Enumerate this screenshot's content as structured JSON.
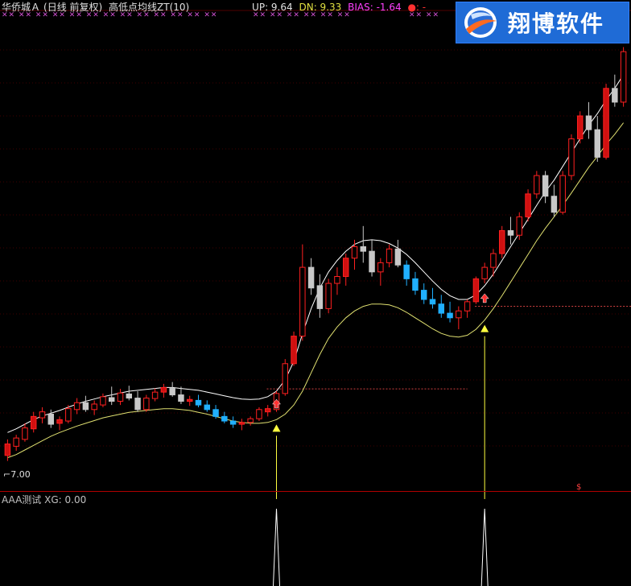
{
  "header": {
    "stock_name": "华侨城Ａ",
    "period": "(日线 前复权)",
    "indicator_name": "高低点均线ZT(10)",
    "up_label": "UP: 9.64",
    "dn_label": "DN: 9.33",
    "bias_label": "BIAS: -1.64",
    "dot_label": "●: -",
    "x_marks_left": "✕✕ ✕✕ ✕✕ ✕✕ ✕✕ ✕✕ ✕✕ ✕✕ ✕✕ ✕✕ ✕✕ ✕✕ ✕✕",
    "x_marks_mid": "✕✕ ✕✕ ✕✕ ✕✕ ✕✕ ✕✕",
    "x_marks_right": "✕✕ ✕✕"
  },
  "logo": {
    "text": "翔博软件"
  },
  "low_price_label": "7.00",
  "sub_panel": {
    "title": "AAA测试",
    "value_label": "XG: 0.00"
  },
  "colors": {
    "up": "#ff2020",
    "up_body": "#d01010",
    "down": "#20b0ff",
    "neutral": "#c8c8c8",
    "upper_line": "#ffffff",
    "lower_line": "#e0e070",
    "signal": "#ffff40"
  },
  "icons": {
    "signal_arrow": "up-arrow-icon",
    "buy_marker": "red-up-arrow-icon"
  },
  "chart_data": {
    "type": "candlestick",
    "note_ohlc": "o,h,l,c",
    "candles": [
      [
        7.1,
        7.45,
        6.98,
        7.35
      ],
      [
        7.3,
        7.55,
        7.2,
        7.48
      ],
      [
        7.45,
        7.8,
        7.4,
        7.7
      ],
      [
        7.68,
        8.05,
        7.6,
        7.95
      ],
      [
        7.92,
        8.15,
        7.8,
        8.05
      ],
      [
        8.0,
        8.1,
        7.7,
        7.78
      ],
      [
        7.8,
        7.95,
        7.65,
        7.88
      ],
      [
        7.85,
        8.2,
        7.8,
        8.12
      ],
      [
        8.1,
        8.35,
        8.0,
        8.25
      ],
      [
        8.25,
        8.4,
        8.05,
        8.1
      ],
      [
        8.1,
        8.3,
        7.98,
        8.22
      ],
      [
        8.2,
        8.45,
        8.15,
        8.38
      ],
      [
        8.36,
        8.6,
        8.2,
        8.28
      ],
      [
        8.28,
        8.55,
        8.2,
        8.46
      ],
      [
        8.44,
        8.62,
        8.3,
        8.35
      ],
      [
        8.35,
        8.5,
        8.05,
        8.1
      ],
      [
        8.1,
        8.42,
        8.05,
        8.35
      ],
      [
        8.34,
        8.56,
        8.28,
        8.48
      ],
      [
        8.48,
        8.66,
        8.36,
        8.58
      ],
      [
        8.56,
        8.7,
        8.38,
        8.42
      ],
      [
        8.42,
        8.6,
        8.22,
        8.28
      ],
      [
        8.28,
        8.4,
        8.18,
        8.32
      ],
      [
        8.3,
        8.42,
        8.15,
        8.2
      ],
      [
        8.2,
        8.3,
        8.05,
        8.1
      ],
      [
        8.1,
        8.2,
        7.9,
        7.95
      ],
      [
        7.95,
        8.05,
        7.8,
        7.85
      ],
      [
        7.85,
        7.95,
        7.7,
        7.78
      ],
      [
        7.78,
        7.9,
        7.65,
        7.82
      ],
      [
        7.82,
        7.95,
        7.75,
        7.9
      ],
      [
        7.9,
        8.15,
        7.85,
        8.1
      ],
      [
        8.05,
        8.2,
        7.95,
        8.12
      ],
      [
        8.1,
        8.5,
        8.05,
        8.45
      ],
      [
        8.45,
        9.2,
        8.4,
        9.1
      ],
      [
        9.1,
        9.8,
        9.05,
        9.7
      ],
      [
        9.7,
        11.7,
        9.6,
        11.2
      ],
      [
        11.2,
        11.4,
        10.6,
        10.75
      ],
      [
        10.8,
        11.05,
        10.1,
        10.3
      ],
      [
        10.3,
        10.95,
        10.2,
        10.85
      ],
      [
        10.85,
        11.2,
        10.6,
        11.0
      ],
      [
        11.0,
        11.5,
        10.8,
        11.4
      ],
      [
        11.4,
        11.8,
        11.15,
        11.65
      ],
      [
        11.65,
        12.1,
        11.3,
        11.55
      ],
      [
        11.55,
        11.8,
        11.0,
        11.1
      ],
      [
        11.1,
        11.4,
        10.8,
        11.3
      ],
      [
        11.3,
        11.7,
        11.2,
        11.6
      ],
      [
        11.6,
        11.8,
        11.2,
        11.25
      ],
      [
        11.25,
        11.35,
        10.8,
        10.95
      ],
      [
        10.95,
        11.1,
        10.6,
        10.7
      ],
      [
        10.7,
        10.85,
        10.4,
        10.5
      ],
      [
        10.5,
        10.75,
        10.3,
        10.4
      ],
      [
        10.4,
        10.6,
        10.1,
        10.2
      ],
      [
        10.2,
        10.45,
        10.0,
        10.1
      ],
      [
        10.1,
        10.35,
        9.85,
        10.25
      ],
      [
        10.25,
        10.5,
        10.1,
        10.45
      ],
      [
        10.45,
        11.0,
        10.4,
        10.95
      ],
      [
        10.95,
        11.3,
        10.85,
        11.2
      ],
      [
        11.2,
        11.6,
        11.0,
        11.5
      ],
      [
        11.5,
        12.1,
        11.4,
        12.0
      ],
      [
        12.0,
        12.3,
        11.7,
        11.9
      ],
      [
        11.9,
        12.4,
        11.8,
        12.3
      ],
      [
        12.3,
        12.9,
        12.2,
        12.8
      ],
      [
        12.8,
        13.3,
        12.7,
        13.2
      ],
      [
        13.2,
        13.3,
        12.6,
        12.75
      ],
      [
        12.75,
        13.0,
        12.3,
        12.4
      ],
      [
        12.4,
        13.3,
        12.35,
        13.2
      ],
      [
        13.2,
        14.1,
        13.1,
        14.0
      ],
      [
        14.0,
        14.6,
        13.9,
        14.5
      ],
      [
        14.5,
        14.8,
        14.0,
        14.2
      ],
      [
        14.2,
        14.5,
        13.5,
        13.6
      ],
      [
        13.6,
        15.2,
        13.55,
        15.1
      ],
      [
        15.1,
        15.4,
        14.7,
        14.8
      ],
      [
        14.8,
        16.0,
        14.7,
        15.9
      ]
    ],
    "upper_band": [
      7.6,
      7.68,
      7.78,
      7.88,
      7.96,
      8.02,
      8.08,
      8.15,
      8.22,
      8.28,
      8.33,
      8.38,
      8.42,
      8.46,
      8.5,
      8.52,
      8.54,
      8.56,
      8.58,
      8.58,
      8.56,
      8.54,
      8.52,
      8.48,
      8.44,
      8.4,
      8.36,
      8.33,
      8.32,
      8.33,
      8.38,
      8.5,
      8.75,
      9.15,
      9.75,
      10.3,
      10.75,
      11.1,
      11.35,
      11.55,
      11.7,
      11.78,
      11.8,
      11.78,
      11.72,
      11.62,
      11.48,
      11.3,
      11.1,
      10.9,
      10.72,
      10.58,
      10.5,
      10.5,
      10.6,
      10.8,
      11.05,
      11.35,
      11.65,
      11.95,
      12.25,
      12.55,
      12.85,
      13.1,
      13.4,
      13.7,
      14.0,
      14.3,
      14.55,
      14.85,
      15.1,
      15.4
    ],
    "lower_band": [
      7.05,
      7.12,
      7.22,
      7.32,
      7.42,
      7.52,
      7.6,
      7.67,
      7.74,
      7.8,
      7.86,
      7.92,
      7.96,
      8.0,
      8.04,
      8.06,
      8.08,
      8.1,
      8.12,
      8.12,
      8.1,
      8.08,
      8.04,
      8.0,
      7.95,
      7.9,
      7.85,
      7.82,
      7.8,
      7.8,
      7.82,
      7.88,
      8.0,
      8.2,
      8.5,
      8.9,
      9.3,
      9.65,
      9.9,
      10.1,
      10.25,
      10.35,
      10.4,
      10.4,
      10.38,
      10.32,
      10.22,
      10.1,
      9.98,
      9.86,
      9.76,
      9.7,
      9.68,
      9.72,
      9.85,
      10.05,
      10.3,
      10.58,
      10.88,
      11.18,
      11.48,
      11.78,
      12.05,
      12.3,
      12.55,
      12.82,
      13.1,
      13.38,
      13.62,
      13.88,
      14.1,
      14.35
    ],
    "y_range": [
      6.5,
      16.5
    ],
    "signal_indices": [
      31,
      55
    ],
    "signal_levels_dotted": [
      8.55,
      10.35
    ],
    "xg_values_peak_indices": [
      31,
      55
    ]
  }
}
